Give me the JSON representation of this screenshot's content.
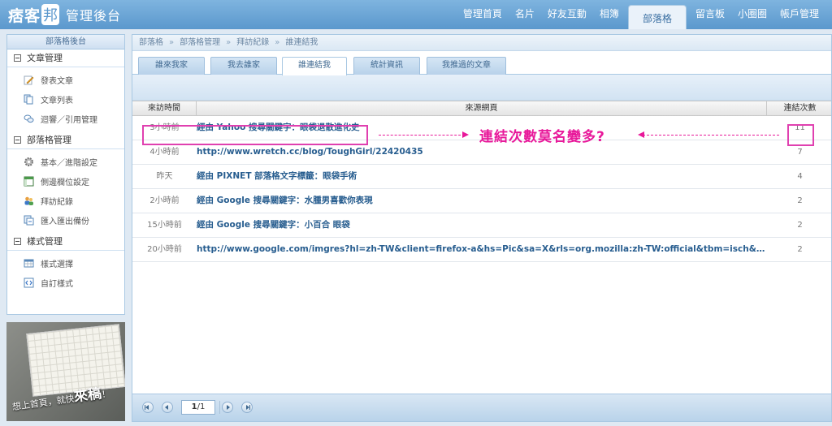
{
  "header": {
    "logo": "痞客",
    "logo_badge": "邦",
    "subtitle": "管理後台",
    "nav": [
      {
        "label": "管理首頁",
        "active": false
      },
      {
        "label": "名片",
        "active": false
      },
      {
        "label": "好友互動",
        "active": false
      },
      {
        "label": "相簿",
        "active": false
      },
      {
        "label": "部落格",
        "active": true
      },
      {
        "label": "留言板",
        "active": false
      },
      {
        "label": "小圈圈",
        "active": false
      },
      {
        "label": "帳戶管理",
        "active": false
      }
    ]
  },
  "sidebar": {
    "title": "部落格後台",
    "sections": [
      {
        "label": "文章管理",
        "items": [
          {
            "label": "發表文章",
            "icon": "pencil-icon"
          },
          {
            "label": "文章列表",
            "icon": "pages-icon"
          },
          {
            "label": "迴響／引用管理",
            "icon": "speech-bubble-icon"
          }
        ]
      },
      {
        "label": "部落格管理",
        "items": [
          {
            "label": "基本／進階設定",
            "icon": "gear-icon"
          },
          {
            "label": "側邊欄位設定",
            "icon": "layout-icon"
          },
          {
            "label": "拜訪紀錄",
            "icon": "visitors-icon"
          },
          {
            "label": "匯入匯出備份",
            "icon": "backup-icon"
          }
        ]
      },
      {
        "label": "樣式管理",
        "items": [
          {
            "label": "樣式選擇",
            "icon": "grid-icon"
          },
          {
            "label": "自訂樣式",
            "icon": "code-icon"
          }
        ]
      }
    ],
    "ad": {
      "line1": "想上首頁，就快",
      "line2": "來稿",
      "line3": "！"
    }
  },
  "breadcrumb": [
    "部落格",
    "部落格管理",
    "拜訪紀錄",
    "誰連結我"
  ],
  "tabs": [
    {
      "label": "誰來我家",
      "active": false
    },
    {
      "label": "我去誰家",
      "active": false
    },
    {
      "label": "誰連結我",
      "active": true
    },
    {
      "label": "統計資訊",
      "active": false
    },
    {
      "label": "我推過的文章",
      "active": false
    }
  ],
  "table": {
    "headers": [
      "來訪時間",
      "來源網頁",
      "連結次數"
    ],
    "rows": [
      {
        "time": "3小時前",
        "source": "經由 Yahoo 搜尋關鍵字：眼袋退散進化史",
        "count": "11"
      },
      {
        "time": "4小時前",
        "source": "http://www.wretch.cc/blog/ToughGirl/22420435",
        "count": "7"
      },
      {
        "time": "昨天",
        "source": "經由 PIXNET 部落格文字標籤：眼袋手術",
        "count": "4"
      },
      {
        "time": "2小時前",
        "source": "經由 Google 搜尋關鍵字：水腫男喜歡你表現",
        "count": "2"
      },
      {
        "time": "15小時前",
        "source": "經由 Google 搜尋關鍵字：小百合 眼袋",
        "count": "2"
      },
      {
        "time": "20小時前",
        "source": "http://www.google.com/imgres?hl=zh-TW&client=firefox-a&hs=Pic&sa=X&rls=org.mozilla:zh-TW:official&tbm=isch&prmd=imvn...",
        "count": "2"
      }
    ]
  },
  "annotation": {
    "text": "連結次數莫名變多?",
    "color": "#e8189a"
  },
  "pager": {
    "page": "1",
    "total": "1"
  }
}
